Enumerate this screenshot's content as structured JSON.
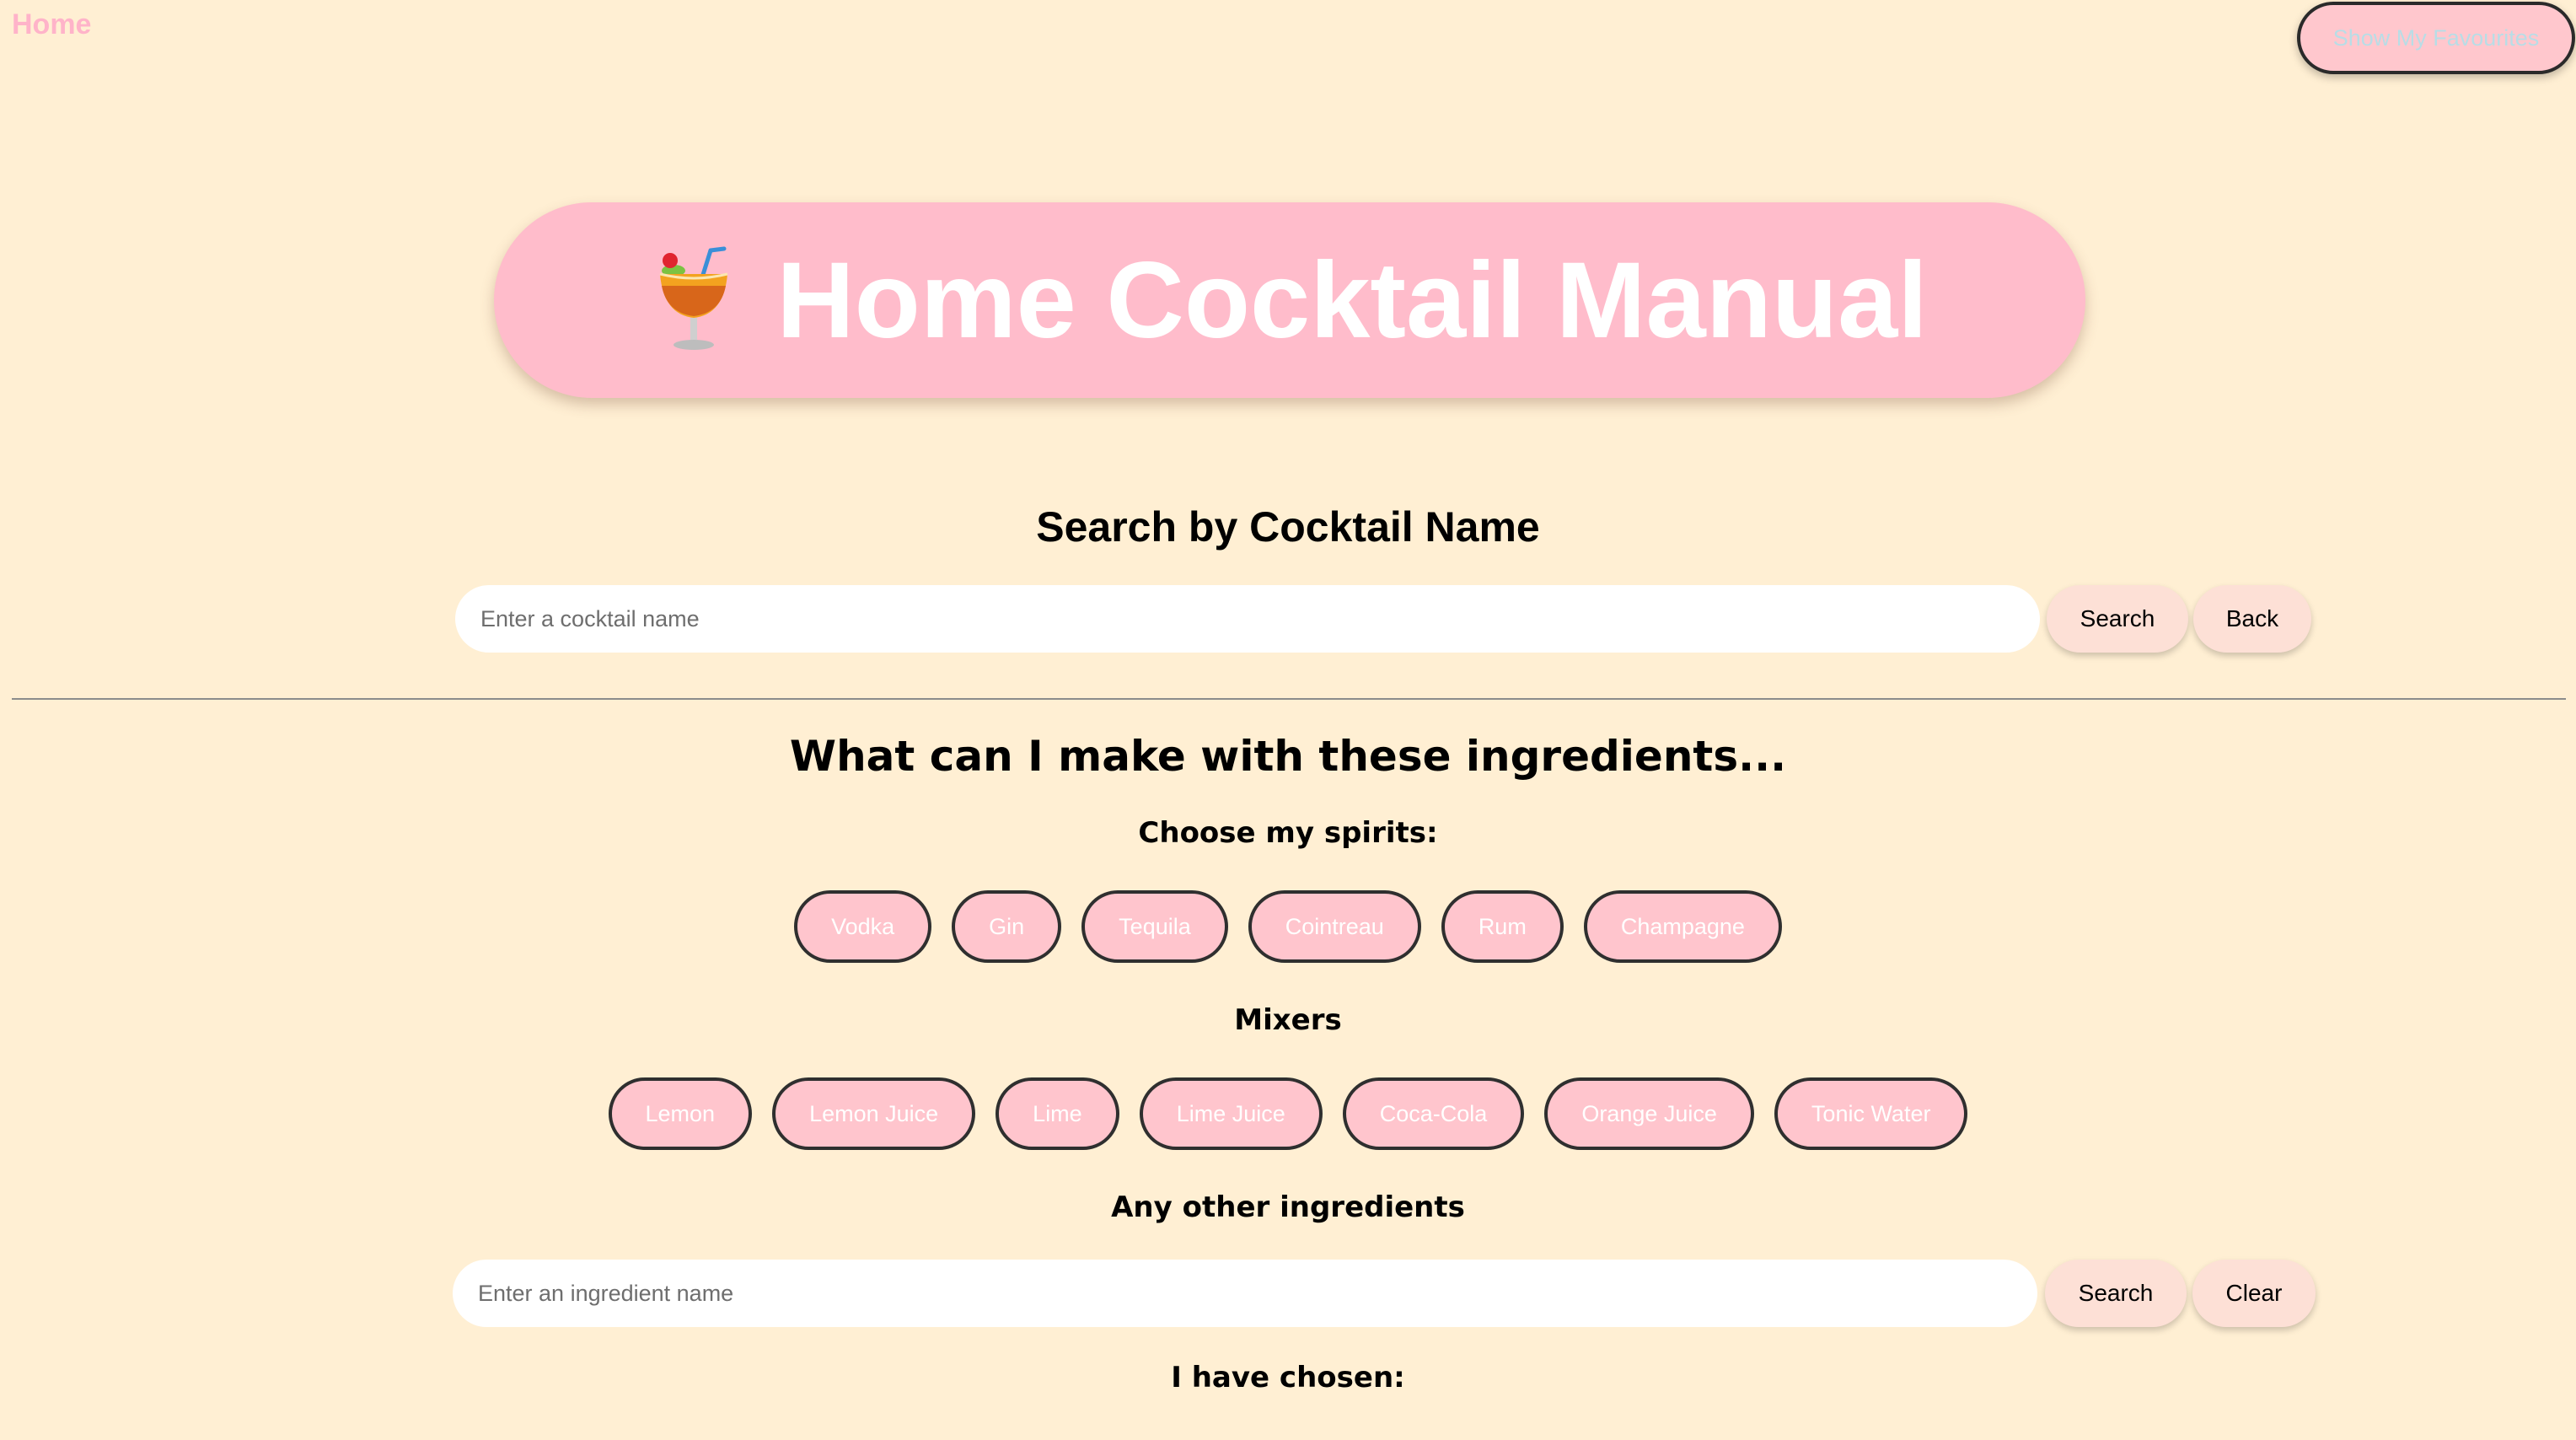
{
  "nav": {
    "home_label": "Home",
    "favourites_label": "Show My Favourites"
  },
  "hero": {
    "icon": "tropical-drink-icon",
    "title": "Home Cocktail Manual"
  },
  "name_search": {
    "heading": "Search by Cocktail Name",
    "placeholder": "Enter a cocktail name",
    "search_label": "Search",
    "back_label": "Back"
  },
  "ingredients": {
    "heading": "What can I make with these ingredients...",
    "spirits_heading": "Choose my spirits:",
    "spirits": [
      "Vodka",
      "Gin",
      "Tequila",
      "Cointreau",
      "Rum",
      "Champagne"
    ],
    "mixers_heading": "Mixers",
    "mixers": [
      "Lemon",
      "Lemon Juice",
      "Lime",
      "Lime Juice",
      "Coca-Cola",
      "Orange Juice",
      "Tonic Water"
    ],
    "other_heading": "Any other ingredients",
    "other_placeholder": "Enter an ingredient name",
    "search_label": "Search",
    "clear_label": "Clear",
    "chosen_heading": "I have chosen:"
  },
  "colors": {
    "background": "#ffefd3",
    "hero_pink": "#ffbccb",
    "chip_pink": "#ffc5cd",
    "button_peach": "#fde0d6",
    "home_link": "#ffb3c9"
  }
}
